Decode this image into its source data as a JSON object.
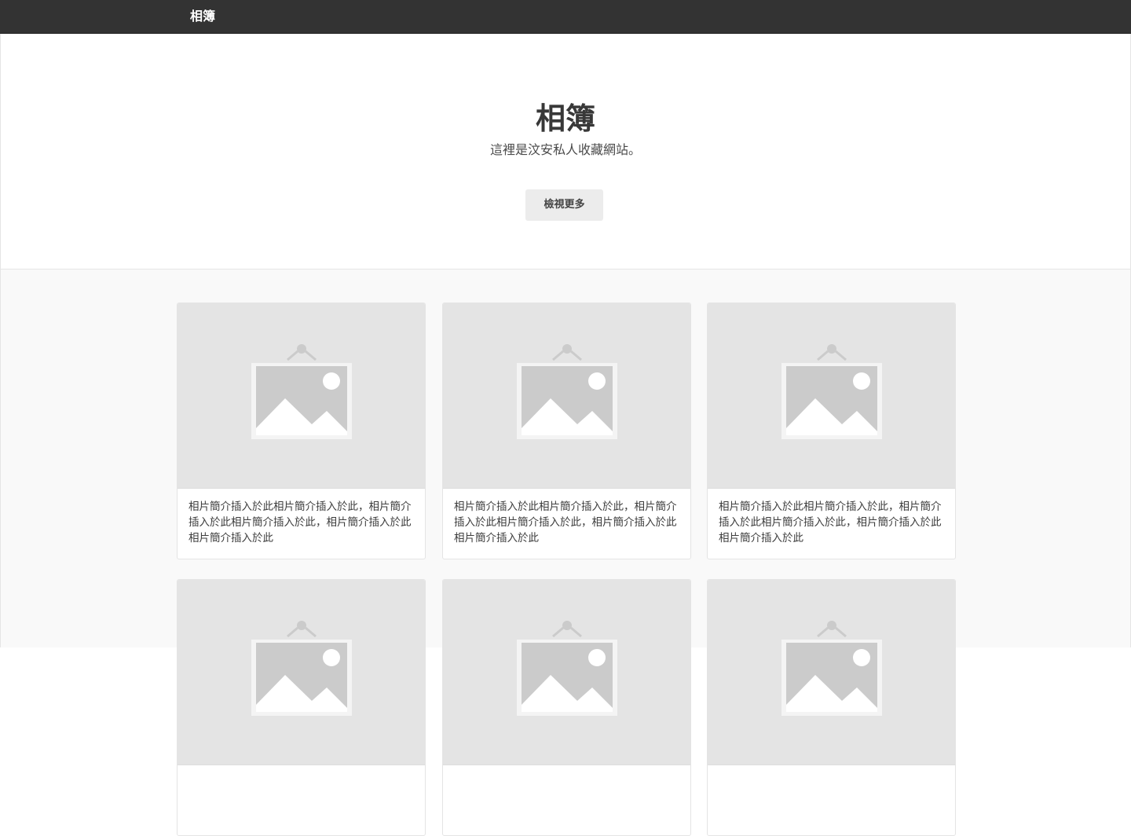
{
  "navbar": {
    "brand": "相簿"
  },
  "hero": {
    "title": "相簿",
    "lead": "這裡是汶安私人收藏網站。",
    "button_label": "檢視更多"
  },
  "album": {
    "cards": [
      {
        "image_icon": "image-placeholder-icon",
        "text": "相片簡介插入於此相片簡介插入於此，相片簡介插入於此相片簡介插入於此，相片簡介插入於此相片簡介插入於此"
      },
      {
        "image_icon": "image-placeholder-icon",
        "text": "相片簡介插入於此相片簡介插入於此，相片簡介插入於此相片簡介插入於此，相片簡介插入於此相片簡介插入於此"
      },
      {
        "image_icon": "image-placeholder-icon",
        "text": "相片簡介插入於此相片簡介插入於此，相片簡介插入於此相片簡介插入於此，相片簡介插入於此相片簡介插入於此"
      },
      {
        "image_icon": "image-placeholder-icon",
        "text": ""
      },
      {
        "image_icon": "image-placeholder-icon",
        "text": ""
      },
      {
        "image_icon": "image-placeholder-icon",
        "text": ""
      }
    ]
  },
  "colors": {
    "navbar_bg": "#333333",
    "hero_bg": "#ffffff",
    "album_bg": "#f9f9f9",
    "thumb_bg": "#e4e4e4",
    "button_bg": "#ececec"
  }
}
